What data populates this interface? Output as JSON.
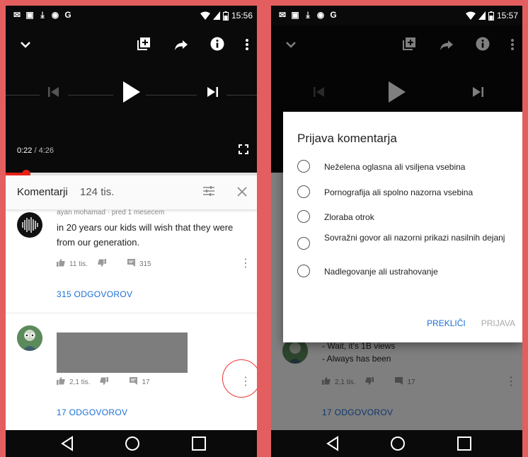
{
  "left": {
    "status_time": "15:56",
    "player": {
      "current_time": "0:22",
      "duration": "4:26",
      "separator": " / ",
      "progress_fraction": 0.083
    },
    "comments_header": {
      "title": "Komentarji",
      "count": "124 tis."
    },
    "comments": [
      {
        "meta": "ayan mohamad · pred 1 mesecem",
        "text": "in 20 years our kids will wish that they were from our generation.",
        "likes": "11 tis.",
        "replies_count": "315",
        "replies_link": "315 ODGOVOROV"
      },
      {
        "likes": "2,1 tis.",
        "replies_count": "17",
        "replies_link": "17 ODGOVOROV"
      }
    ]
  },
  "right": {
    "status_time": "15:57",
    "dialog": {
      "title": "Prijava komentarja",
      "options": [
        "Neželena oglasna ali vsiljena vsebina",
        "Pornografija ali spolno nazorna vsebina",
        "Zloraba otrok",
        "Sovražni govor ali nazorni prikazi nasilnih dejanj",
        "Nadlegovanje ali ustrahovanje"
      ],
      "cancel_label": "PREKLIČI",
      "report_label": "PRIJAVA"
    },
    "background_comment": {
      "line1": "- Wait, it's 1B views",
      "line2": "- Always has been",
      "likes": "2,1 tis.",
      "replies_count": "17",
      "replies_link": "17 ODGOVOROV"
    }
  },
  "colors": {
    "accent_red": "#e62117",
    "link_blue": "#1a6fd6",
    "frame": "#e35f5f"
  },
  "icons": [
    "mail-icon",
    "image-icon",
    "download-icon",
    "app-icon",
    "google-icon",
    "wifi-icon",
    "signal-icon",
    "battery-icon",
    "chevron-down-icon",
    "add-to-playlist-icon",
    "share-icon",
    "info-icon",
    "more-vert-icon",
    "prev-icon",
    "play-icon",
    "next-icon",
    "fullscreen-icon",
    "sort-icon",
    "close-icon",
    "thumb-up-icon",
    "thumb-down-icon",
    "comment-icon",
    "back-nav-icon",
    "home-nav-icon",
    "recents-nav-icon"
  ]
}
